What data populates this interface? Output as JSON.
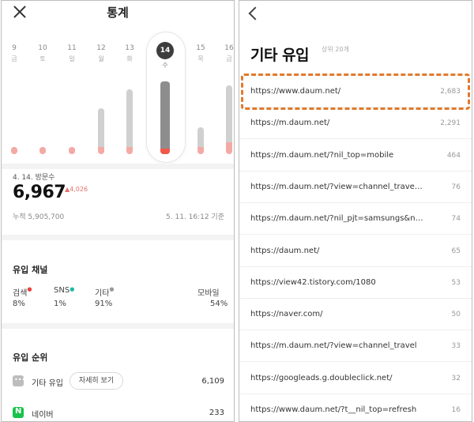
{
  "left": {
    "title": "통계",
    "days": [
      {
        "d": "9",
        "w": "금",
        "value": 0.06,
        "highlight": 0.06
      },
      {
        "d": "10",
        "w": "토",
        "value": 0.06,
        "highlight": 0.06
      },
      {
        "d": "11",
        "w": "일",
        "value": 0.06,
        "highlight": 0.06
      },
      {
        "d": "12",
        "w": "월",
        "value": 0.39,
        "highlight": 0.06
      },
      {
        "d": "13",
        "w": "화",
        "value": 0.55,
        "highlight": 0.06
      },
      {
        "d": "15",
        "w": "목",
        "value": 0.23,
        "highlight": 0.06
      },
      {
        "d": "16",
        "w": "금",
        "value": 0.58,
        "highlight": 0.1
      }
    ],
    "selected_day": {
      "d": "14",
      "w": "수",
      "value": 0.93,
      "highlight": 0.05
    },
    "visit_label": "4. 14. 방문수",
    "visit_count": "6,967",
    "visit_delta": "▲4,026",
    "cumulative": "누적 5,905,700",
    "as_of": "5. 11. 16:12 기준",
    "channel_title": "유입 채널",
    "channels": [
      {
        "label": "검색",
        "dot": "●",
        "dot_color": "#e8423a",
        "value": "8%"
      },
      {
        "label": "SNS",
        "dot": "●",
        "dot_color": "#1fb8a8",
        "value": "1%"
      },
      {
        "label": "기타",
        "dot": "●",
        "dot_color": "#999999",
        "value": "91%"
      },
      {
        "label": "모바일",
        "dot": "",
        "dot_color": "#999999",
        "value": "54%"
      }
    ],
    "rank_title": "유입 순위",
    "ranks": [
      {
        "name": "기타 유입",
        "value": "6,109",
        "icon_color": "#bdbdbd",
        "icon": "ellipsis-icon"
      },
      {
        "name": "네이버",
        "value": "233",
        "icon_color": "#19c24a",
        "icon": "naver-icon",
        "icon_text": "N"
      }
    ],
    "detail_button": "자세히 보기"
  },
  "right": {
    "title": "기타 유입",
    "subtitle": "상위 20개",
    "rows": [
      {
        "url": "https://www.daum.net/",
        "count": "2,683"
      },
      {
        "url": "https://m.daum.net/",
        "count": "2,291"
      },
      {
        "url": "https://m.daum.net/?nil_top=mobile",
        "count": "464"
      },
      {
        "url": "https://m.daum.net/?view=channel_trave…",
        "count": "76"
      },
      {
        "url": "https://m.daum.net/?nil_pjt=samsungs&n…",
        "count": "74"
      },
      {
        "url": "https://daum.net/",
        "count": "65"
      },
      {
        "url": "https://view42.tistory.com/1080",
        "count": "53"
      },
      {
        "url": "https://naver.com/",
        "count": "50"
      },
      {
        "url": "https://m.daum.net/?view=channel_travel",
        "count": "33"
      },
      {
        "url": "https://googleads.g.doubleclick.net/",
        "count": "32"
      },
      {
        "url": "https://www.daum.net/?t__nil_top=refresh",
        "count": "16"
      }
    ]
  }
}
